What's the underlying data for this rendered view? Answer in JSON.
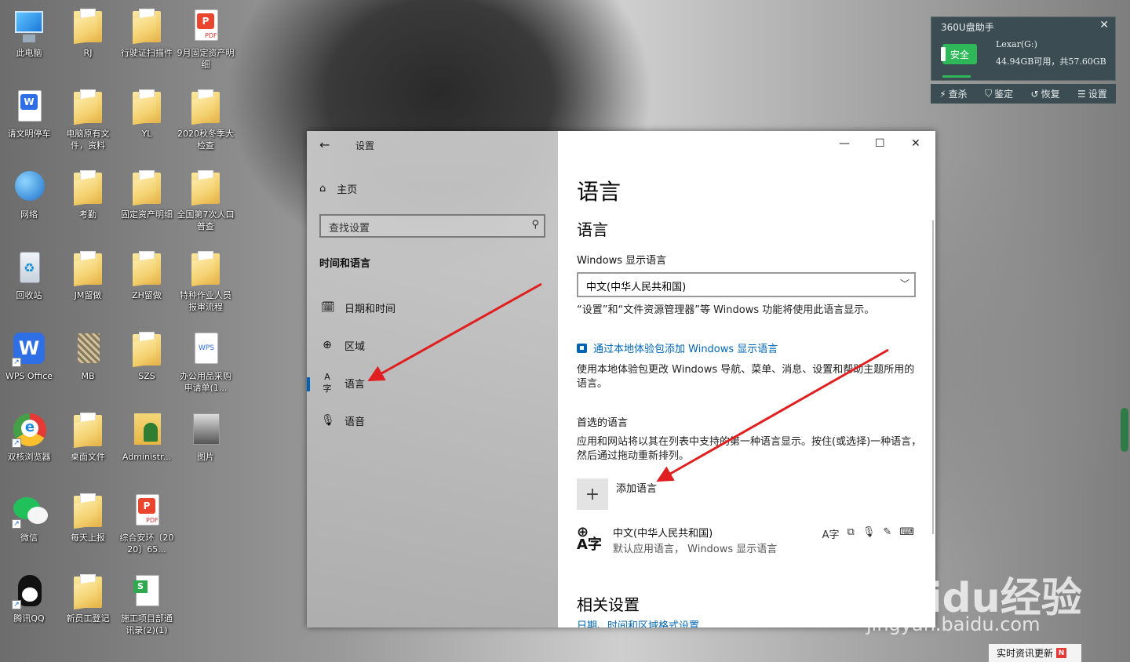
{
  "desktop": {
    "icons": [
      {
        "label": "此电脑",
        "kind": "pc"
      },
      {
        "label": "RJ",
        "kind": "folder"
      },
      {
        "label": "行驶证扫描件",
        "kind": "folder"
      },
      {
        "label": "9月固定资产明细",
        "kind": "pdf"
      },
      {
        "label": "请文明停车",
        "kind": "doc"
      },
      {
        "label": "电脑原有文件，资料",
        "kind": "folder"
      },
      {
        "label": "YL",
        "kind": "folder"
      },
      {
        "label": "2020秋冬季大检查",
        "kind": "folder"
      },
      {
        "label": "网络",
        "kind": "network"
      },
      {
        "label": "考勤",
        "kind": "folder"
      },
      {
        "label": "固定资产明细",
        "kind": "folder"
      },
      {
        "label": "全国第7次人口普查",
        "kind": "folder"
      },
      {
        "label": "回收站",
        "kind": "recycle"
      },
      {
        "label": "JM留做",
        "kind": "folder"
      },
      {
        "label": "ZH留做",
        "kind": "folder"
      },
      {
        "label": "特种作业人员报审流程",
        "kind": "folder"
      },
      {
        "label": "WPS Office",
        "kind": "wps"
      },
      {
        "label": "MB",
        "kind": "mb"
      },
      {
        "label": "SZS",
        "kind": "folder"
      },
      {
        "label": "办公用品采购申请单(1...",
        "kind": "doc"
      },
      {
        "label": "双核浏览器",
        "kind": "browser"
      },
      {
        "label": "桌面文件",
        "kind": "folder"
      },
      {
        "label": "Administr...",
        "kind": "admin"
      },
      {
        "label": "图片",
        "kind": "img"
      },
      {
        "label": "微信",
        "kind": "wechat"
      },
      {
        "label": "每天上报",
        "kind": "folder"
      },
      {
        "label": "综合安环〔2020〕65...",
        "kind": "pdf"
      },
      {
        "label": "腾讯QQ",
        "kind": "qq"
      },
      {
        "label": "新员工登记",
        "kind": "folder"
      },
      {
        "label": "施工项目部通讯录(2)(1)",
        "kind": "xls"
      }
    ]
  },
  "usb_widget": {
    "title": "360U盘助手",
    "status": "安全",
    "device": "Lexar(G:)",
    "capacity": "44.94GB可用，共57.60GB",
    "actions": [
      "查杀",
      "鉴定",
      "恢复",
      "设置"
    ]
  },
  "settings": {
    "title": "设置",
    "home": "主页",
    "search_placeholder": "查找设置",
    "section": "时间和语言",
    "nav": [
      {
        "label": "日期和时间",
        "icon": "calendar-clock-icon"
      },
      {
        "label": "区域",
        "icon": "globe-icon"
      },
      {
        "label": "语言",
        "icon": "language-icon"
      },
      {
        "label": "语音",
        "icon": "microphone-icon"
      }
    ],
    "active_nav": "语言",
    "page_title": "语言",
    "subheading": "语言",
    "display_lang_label": "Windows 显示语言",
    "display_lang_value": "中文(中华人民共和国)",
    "display_lang_note": "“设置”和“文件资源管理器”等 Windows 功能将使用此语言显示。",
    "add_pack_link": "通过本地体验包添加 Windows 显示语言",
    "pack_desc": "使用本地体验包更改 Windows 导航、菜单、消息、设置和帮助主题所用的语言。",
    "preferred_label": "首选的语言",
    "preferred_desc": "应用和网站将以其在列表中支持的第一种语言显示。按住(或选择)一种语言，然后通过拖动重新排列。",
    "add_lang": "添加语言",
    "lang_item_name": "中文(中华人民共和国)",
    "lang_item_sub": "默认应用语言，   Windows 显示语言",
    "related_heading": "相关设置",
    "related_link": "日期、时间和区域格式设置"
  },
  "watermark": {
    "brand": "Baidu经验",
    "url": "jingyan.baidu.com"
  },
  "news_button": "实时资讯更新",
  "accent_color": "#0063b1",
  "arrow_color": "#e02020"
}
